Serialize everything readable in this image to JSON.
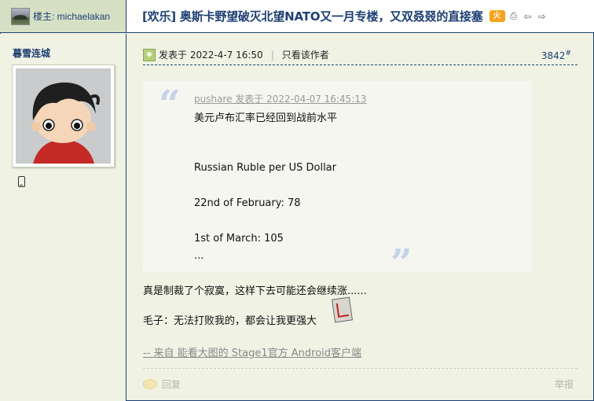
{
  "header": {
    "op_label": "楼主: michaelakan",
    "thread_title": "[欢乐] 奥斯卡野望破灭北望NATO又一月专楼，又双叒叕的直接塞",
    "hot_badge": "火"
  },
  "author": {
    "username": "暮雪连城"
  },
  "post": {
    "posted_at": "发表于 2022-4-7 16:50",
    "only_author": "只看该作者",
    "floor": "3842",
    "floor_mark": "#",
    "quote": {
      "author_line": "pushare 发表于 2022-04-07 16:45:13",
      "lines": [
        "美元卢布汇率已经回到战前水平",
        "Russian Ruble per US Dollar",
        "22nd of February: 78",
        "1st of March: 105",
        "..."
      ]
    },
    "body_lines": [
      "真是制裁了个寂寞，这样下去可能还会继续涨......",
      "毛子：无法打败我的，都会让我更强大"
    ],
    "client_link": " -- 来自 能看大图的 Stage1官方 Android客户端",
    "reply_label": "回复",
    "report_label": "举报"
  }
}
